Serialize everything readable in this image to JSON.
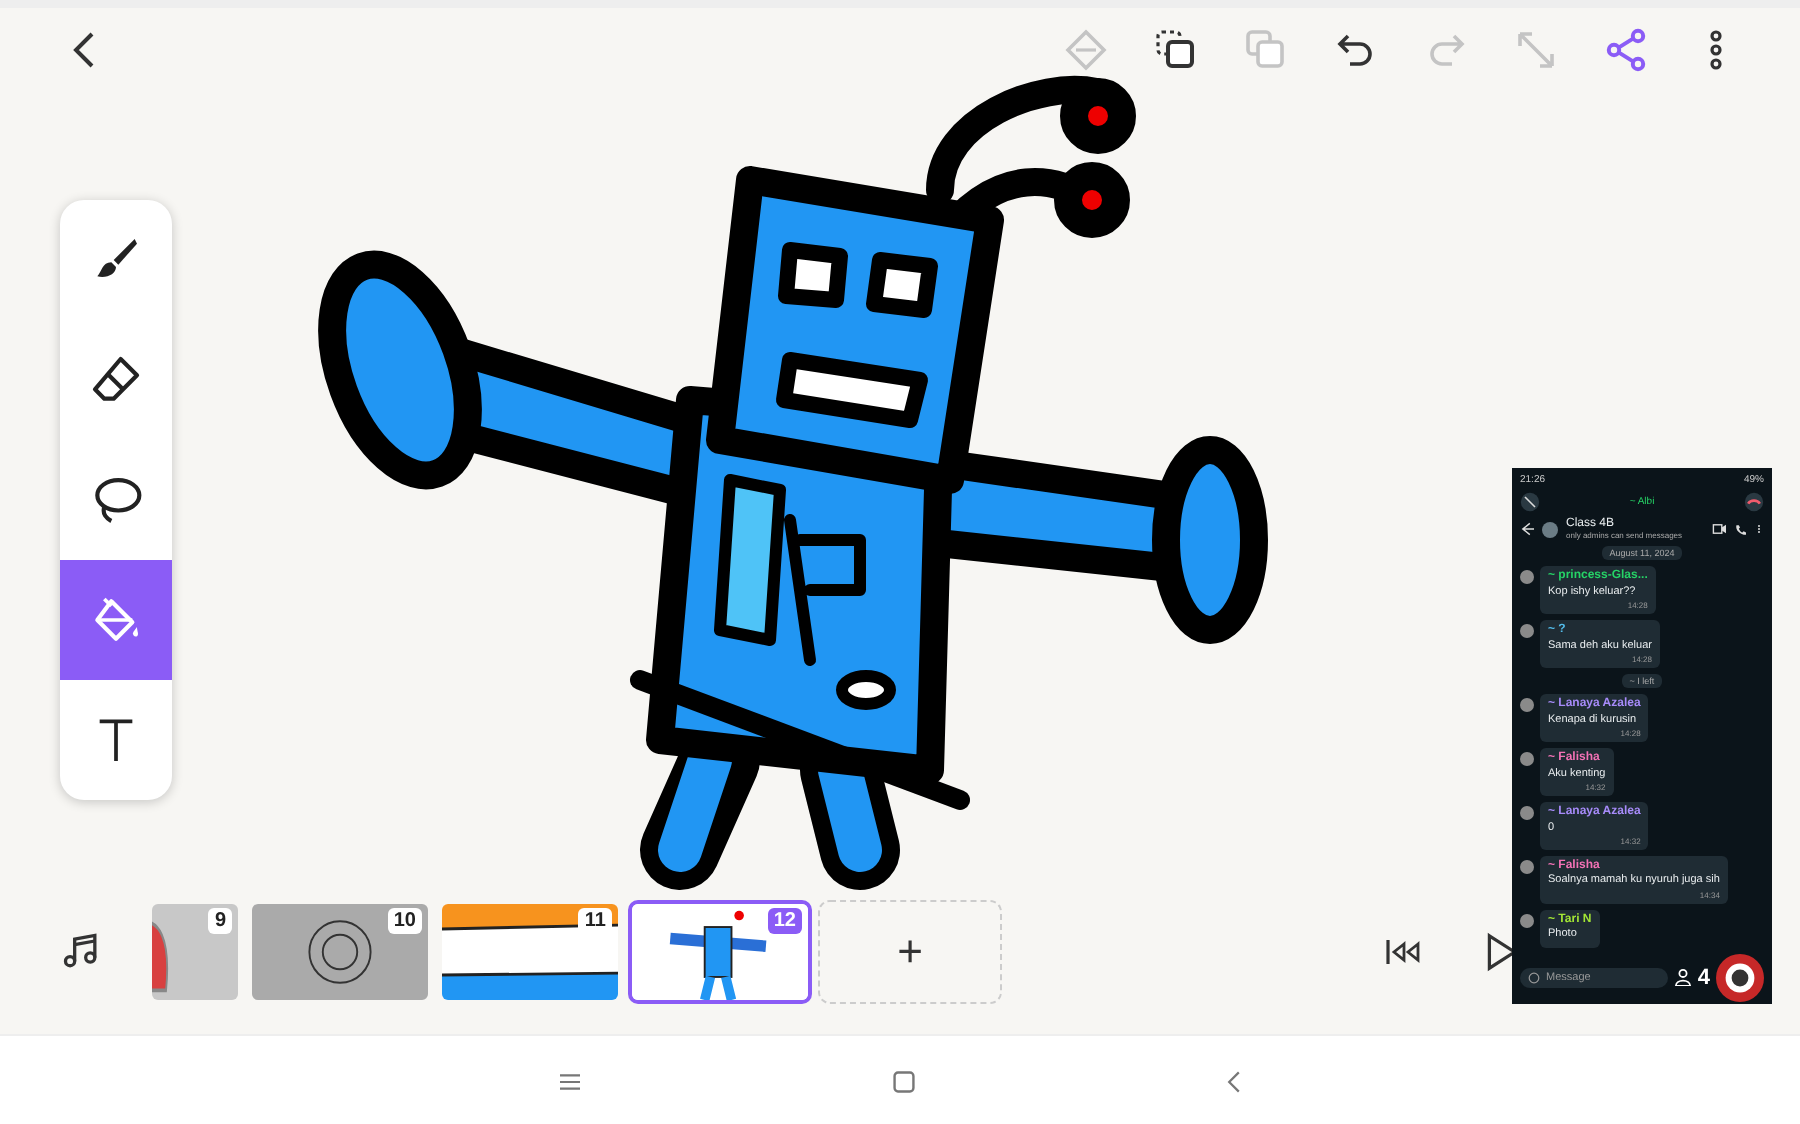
{
  "top_actions": [
    {
      "kind": "layers",
      "disabled": true
    },
    {
      "kind": "duplicate",
      "disabled": false
    },
    {
      "kind": "copy",
      "disabled": true
    },
    {
      "kind": "undo",
      "disabled": false
    },
    {
      "kind": "redo",
      "disabled": true
    },
    {
      "kind": "resize",
      "disabled": true
    },
    {
      "kind": "share",
      "disabled": false
    },
    {
      "kind": "more",
      "disabled": false
    }
  ],
  "tools": [
    {
      "kind": "brush",
      "selected": false
    },
    {
      "kind": "eraser",
      "selected": false
    },
    {
      "kind": "lasso",
      "selected": false
    },
    {
      "kind": "fill",
      "selected": true
    },
    {
      "kind": "text",
      "selected": false
    }
  ],
  "frames": [
    {
      "number": "9",
      "kind": "shield",
      "selected": false
    },
    {
      "number": "10",
      "kind": "sun",
      "selected": false
    },
    {
      "number": "11",
      "kind": "stripes",
      "selected": false
    },
    {
      "number": "12",
      "kind": "robot",
      "selected": true
    }
  ],
  "add_frame": {
    "label": "+"
  },
  "chat_overlay": {
    "time": "21:26",
    "battery": "49%",
    "caller": "~ Albi",
    "group": "Class 4B",
    "subtitle": "only admins can send messages",
    "date": "August 11, 2024",
    "messages": [
      {
        "kind": "message",
        "sender": "~ princess-Glas...",
        "text": "Kop ishy keluar??",
        "time": "14:28",
        "color": "#25d366"
      },
      {
        "kind": "message",
        "sender": "~ ?",
        "text": "Sama deh aku keluar",
        "time": "14:28",
        "color": "#53bdeb"
      },
      {
        "kind": "system",
        "text": "~ I left"
      },
      {
        "kind": "message",
        "sender": "~ Lanaya Azalea",
        "text": "Kenapa di kurusin",
        "time": "14:28",
        "color": "#a78bfa"
      },
      {
        "kind": "message",
        "sender": "~ Falisha",
        "text": "Aku kenting",
        "time": "14:32",
        "color": "#f472b6"
      },
      {
        "kind": "message",
        "sender": "~ Lanaya Azalea",
        "text": "0",
        "time": "14:32",
        "color": "#a78bfa"
      },
      {
        "kind": "message",
        "sender": "~ Falisha",
        "text": "Soalnya mamah ku nyuruh juga sih",
        "time": "14:34",
        "color": "#f472b6"
      },
      {
        "kind": "message",
        "sender": "~ Tari N",
        "text": "Photo",
        "color": "#a3e635"
      }
    ],
    "input_placeholder": "Message",
    "count": "4"
  }
}
